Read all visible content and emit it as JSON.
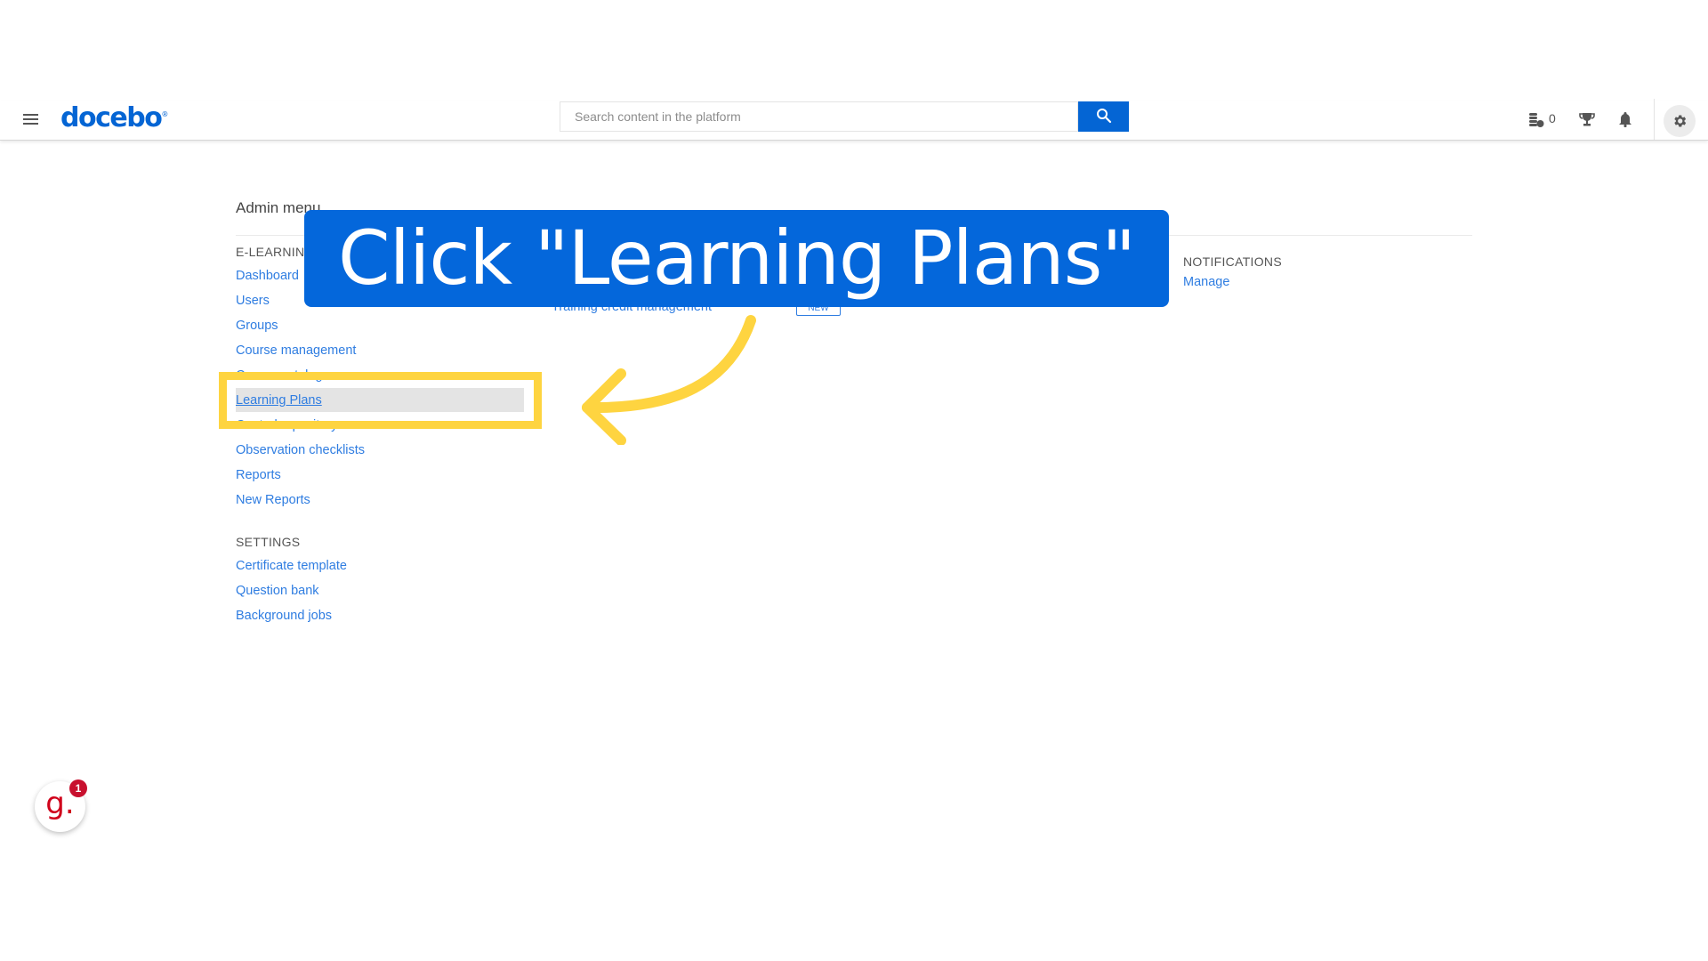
{
  "header": {
    "logo": "docebo",
    "logo_mark": "®",
    "search_placeholder": "Search content in the platform",
    "credits_count": "0",
    "icons": [
      "menu-icon",
      "search-icon",
      "coins-icon",
      "trophy-icon",
      "bell-icon",
      "gear-icon"
    ]
  },
  "admin_menu": {
    "title": "Admin menu",
    "elearning": {
      "heading": "E-LEARNING",
      "items": [
        "Dashboard",
        "Users",
        "Groups",
        "Course management",
        "Course catalog",
        "Learning Plans",
        "Central repository",
        "Observation checklists",
        "Reports",
        "New Reports"
      ]
    },
    "settings": {
      "heading": "SETTINGS",
      "items": [
        "Certificate template",
        "Question bank",
        "Background jobs"
      ]
    },
    "middle_column": {
      "item": "Training credit management",
      "badge": "NEW"
    },
    "notifications": {
      "heading": "NOTIFICATIONS",
      "items": [
        "Manage"
      ]
    }
  },
  "overlay": {
    "instruction": "Click \"Learning Plans\"",
    "highlight_color": "#fed440",
    "banner_color": "#0467db"
  },
  "widget": {
    "letter": "g.",
    "badge_count": "1"
  },
  "colors": {
    "brand": "#0465d4",
    "link": "#2f7de1"
  }
}
